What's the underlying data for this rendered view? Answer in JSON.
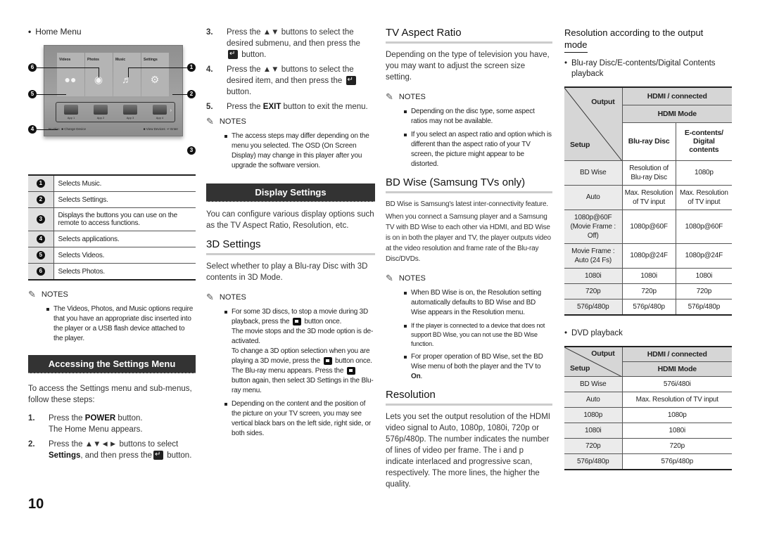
{
  "page_number": "10",
  "col1": {
    "home_menu_bullet": "Home Menu",
    "home_menu": {
      "tiles": [
        {
          "label": "Videos",
          "icon": "video-camera-icon",
          "glyph": "🎥"
        },
        {
          "label": "Photos",
          "icon": "camera-icon",
          "glyph": "📷"
        },
        {
          "label": "Music",
          "icon": "music-disc-icon",
          "glyph": "💿"
        },
        {
          "label": "Settings",
          "icon": "gear-icon",
          "glyph": "⚙"
        }
      ],
      "apps": [
        "App 1",
        "App 2",
        "App 3",
        "App 4"
      ],
      "bottom_left": "No Disc",
      "change_device": "Change Device",
      "view_devices": "View Devices",
      "enter": "Enter",
      "callouts": [
        "1",
        "2",
        "3",
        "4",
        "5",
        "6"
      ]
    },
    "callout_table": [
      {
        "num": "1",
        "text": "Selects Music."
      },
      {
        "num": "2",
        "text": "Selects Settings."
      },
      {
        "num": "3",
        "text": "Displays the buttons you can use on the remote to access functions."
      },
      {
        "num": "4",
        "text": "Selects applications."
      },
      {
        "num": "5",
        "text": "Selects Videos."
      },
      {
        "num": "6",
        "text": "Selects Photos."
      }
    ],
    "notes_label": "NOTES",
    "notes": [
      "The Videos, Photos, and Music options require that you have an appropriate disc inserted into the player or a USB flash device attached to the player."
    ],
    "accessing_header": "Accessing the Settings Menu",
    "accessing_intro": "To access the Settings menu and sub-menus, follow these steps:",
    "steps": [
      {
        "n": "1.",
        "pre": "Press the ",
        "bold": "POWER",
        "post": " button.",
        "line2": "The Home Menu appears."
      },
      {
        "n": "2.",
        "pre": "Press the ▲▼◄► buttons to select ",
        "bold": "Settings",
        "post": ", and then press the",
        "post2": " button."
      }
    ]
  },
  "col2": {
    "steps": [
      {
        "n": "3.",
        "text": "Press the ▲▼ buttons to select the desired submenu, and then press the",
        "tail": " button."
      },
      {
        "n": "4.",
        "text": "Press the ▲▼ buttons to select the desired item, and then press the",
        "tail": " button."
      },
      {
        "n": "5.",
        "pre": "Press the ",
        "bold": "EXIT",
        "post": " button to exit the menu."
      }
    ],
    "notes_label": "NOTES",
    "notes": [
      "The access steps may differ depending on the menu you selected. The OSD (On Screen Display) may change in this player after you upgrade the software version."
    ],
    "display_header": "Display Settings",
    "display_intro": "You can configure various display options such as the TV Aspect Ratio, Resolution, etc.",
    "settings3d_title": "3D Settings",
    "settings3d_intro": "Select whether to play a Blu-ray Disc with 3D contents in 3D Mode.",
    "notes3d_label": "NOTES",
    "note3d_1": {
      "a": "For some 3D discs, to stop a movie during 3D playback, press the",
      "b": " button once.",
      "c": "The movie stops and the 3D mode option is de-activated.",
      "d": "To change a 3D option selection when you are playing a 3D movie, press the",
      "e": " button once. The Blu-ray menu appears. Press the",
      "f": " button again, then select 3D Settings in the Blu-ray menu."
    },
    "note3d_2": "Depending on the content and the position of the picture on your TV screen, you may see vertical black bars on the left side, right side, or both sides."
  },
  "col3": {
    "aspect_title": "TV Aspect Ratio",
    "aspect_intro": "Depending on the type of television you have, you may want to adjust the screen size setting.",
    "aspect_notes_label": "NOTES",
    "aspect_notes": [
      "Depending on the disc type, some aspect ratios may not be available.",
      "If you select an aspect ratio and option which is different than the aspect ratio of your TV screen, the picture might appear to be distorted."
    ],
    "bdwise_title": "BD Wise (Samsung TVs only)",
    "bdwise_p1": "BD Wise is Samsung's latest inter-connectivity feature.",
    "bdwise_p2": "When you connect a Samsung player and a Samsung TV with BD Wise to each other via HDMI, and BD Wise is on in both the player and TV, the player outputs video at the video resolution and frame rate of the Blu-ray Disc/DVDs.",
    "bdwise_notes_label": "NOTES",
    "bdwise_notes": [
      "When BD Wise is on, the Resolution setting automatically defaults to BD Wise and BD Wise appears in the Resolution menu.",
      "If the player is connected to a device that does not support BD Wise, you can not use the BD Wise function."
    ],
    "bdwise_note3_pre": "For proper operation of BD Wise, set the BD Wise menu of both the player and the TV to ",
    "bdwise_note3_bold": "On",
    "bdwise_note3_post": ".",
    "resolution_title": "Resolution",
    "resolution_text": "Lets you set the output resolution of the HDMI video signal to Auto, 1080p, 1080i, 720p or 576p/480p. The number indicates the number of lines of video per frame. The i and p indicate interlaced and progressive scan, respectively. The more lines, the higher the quality."
  },
  "col4": {
    "title_line1": "Resolution according to the output",
    "title_line2": "mode",
    "bluray_bullet": "Blu-ray Disc/E-contents/Digital Contents playback",
    "table1": {
      "corner_output": "Output",
      "corner_setup": "Setup",
      "h_connected": "HDMI / connected",
      "h_mode": "HDMI Mode",
      "h_bluray": "Blu-ray Disc",
      "h_econtents": "E-contents/ Digital contents",
      "rows": [
        [
          "BD Wise",
          "Resolution of Blu-ray Disc",
          "1080p"
        ],
        [
          "Auto",
          "Max. Resolution of TV input",
          "Max. Resolution of TV input"
        ],
        [
          "1080p@60F (Movie Frame : Off)",
          "1080p@60F",
          "1080p@60F"
        ],
        [
          "Movie Frame : Auto (24 Fs)",
          "1080p@24F",
          "1080p@24F"
        ],
        [
          "1080i",
          "1080i",
          "1080i"
        ],
        [
          "720p",
          "720p",
          "720p"
        ],
        [
          "576p/480p",
          "576p/480p",
          "576p/480p"
        ]
      ]
    },
    "dvd_bullet": "DVD playback",
    "table2": {
      "corner_output": "Output",
      "corner_setup": "Setup",
      "h_connected": "HDMI / connected",
      "h_mode": "HDMI Mode",
      "rows": [
        [
          "BD Wise",
          "576i/480i"
        ],
        [
          "Auto",
          "Max. Resolution of TV input"
        ],
        [
          "1080p",
          "1080p"
        ],
        [
          "1080i",
          "1080i"
        ],
        [
          "720p",
          "720p"
        ],
        [
          "576p/480p",
          "576p/480p"
        ]
      ]
    }
  }
}
